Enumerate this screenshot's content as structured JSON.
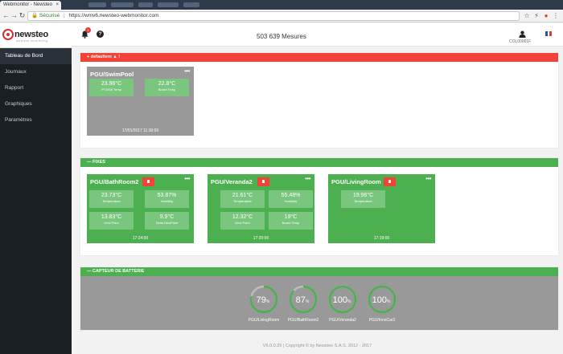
{
  "browser": {
    "tab_title": "Webmonitor - Newsteo",
    "tab_close": "×",
    "secure_label": "Sécurisé",
    "url": "https://wmv6.newsteo-webmonitor.com",
    "url_separator": "|"
  },
  "logo": {
    "name": "newsteo",
    "tagline": "wireless monitoring"
  },
  "sidebar": {
    "items": [
      {
        "label": "Tableau de Bord"
      },
      {
        "label": "Journaux"
      },
      {
        "label": "Rapport"
      },
      {
        "label": "Graphiques"
      },
      {
        "label": "Paramètres"
      }
    ]
  },
  "header": {
    "notification_count": "2",
    "help_label": "?",
    "measures": "503 639 Mesures",
    "user_id": "COL00001F"
  },
  "panels": {
    "defaults": {
      "title": "+ defaultem ▲ !",
      "cards": [
        {
          "title": "PGU/SwimPool",
          "menu": "•••",
          "time": "17/01/2017 11:30:00",
          "tiles": [
            {
              "value": "23.98°C",
              "label": "PT1000 Temp"
            },
            {
              "value": "22.8°C",
              "label": "Board Temp"
            }
          ]
        }
      ]
    },
    "fixes": {
      "title": "— FIXES",
      "cards": [
        {
          "title": "PGU/BathRoom2",
          "menu": "•••",
          "time": "17:24:00",
          "tiles": [
            {
              "value": "23.73°C",
              "label": "Temperature"
            },
            {
              "value": "53.87%",
              "label": "Humidity"
            },
            {
              "value": "13.83°C",
              "label": "Dew Point"
            },
            {
              "value": "9.9°C",
              "label": "Delta DewPoint"
            }
          ]
        },
        {
          "title": "PGU/Veranda2",
          "menu": "•••",
          "time": "17:20:00",
          "tiles": [
            {
              "value": "21.61°C",
              "label": "Temperature"
            },
            {
              "value": "55.48%",
              "label": "Humidity"
            },
            {
              "value": "12.32°C",
              "label": "Dew Point"
            },
            {
              "value": "19°C",
              "label": "Board Temp"
            }
          ]
        },
        {
          "title": "PGU/LivingRoom",
          "menu": "•••",
          "time": "17:19:00",
          "tiles": [
            {
              "value": "19.96°C",
              "label": "Temperature"
            }
          ]
        }
      ]
    },
    "battery": {
      "title": "— CAPTEUR DE BATTERIE",
      "gauges": [
        {
          "value": "79",
          "unit": "%",
          "level": 0.79,
          "label": "PGU/LivingRoom"
        },
        {
          "value": "87",
          "unit": "%",
          "level": 0.87,
          "label": "PGU/BathRoom2"
        },
        {
          "value": "100",
          "unit": "%",
          "level": 1.0,
          "label": "PGU/Veranda2"
        },
        {
          "value": "100",
          "unit": "%",
          "level": 1.0,
          "label": "PGU/InnoCar2"
        }
      ]
    }
  },
  "footer": {
    "text": "V6.0.0.29 | Copyright © by Newsteo S.A.S. 2012 - 2017"
  },
  "colors": {
    "green": "#4caf50",
    "tile_green": "#7bc67e",
    "red": "#f44336",
    "gray": "#999999",
    "sidebar": "#1a1f24"
  }
}
